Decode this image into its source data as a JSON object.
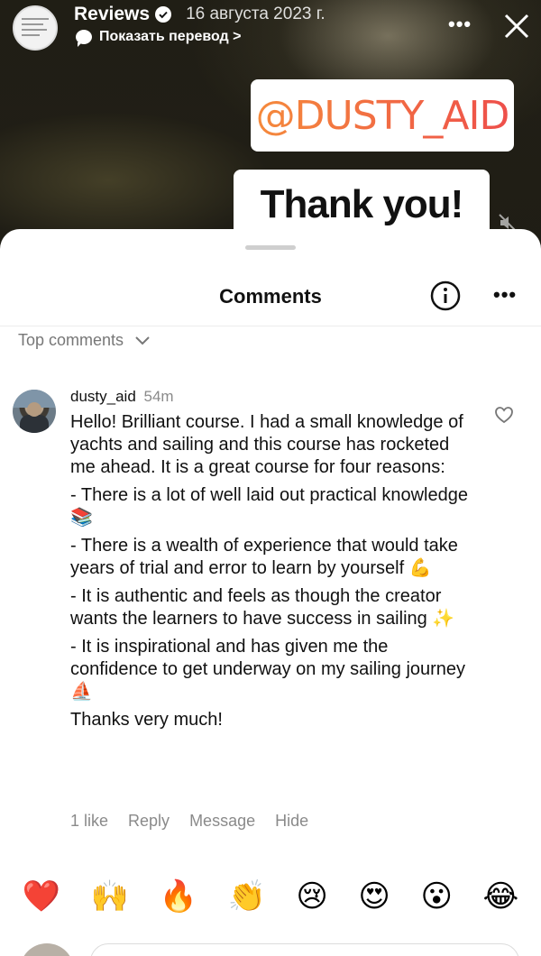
{
  "story": {
    "username": "Reviews",
    "date": "16 августа 2023 г.",
    "translate_label": "Показать перевод >",
    "more_label": "•••",
    "mention_sticker": "@DUSTY_AID",
    "text_sticker": "Thank you!"
  },
  "comments_sheet": {
    "title": "Comments",
    "more_label": "•••",
    "filter_label": "Top comments",
    "comment": {
      "username": "dusty_aid",
      "time": "54m",
      "lines": [
        "Hello! Brilliant course. I had a small knowledge of yachts and sailing and this course has rocketed me ahead. It is a great course for four reasons:",
        "- There is a lot of well laid out practical knowledge 📚",
        "- There is a wealth of experience that would take years of trial and error to learn by yourself 💪",
        "- It is authentic and feels as though the creator wants the learners to have success in sailing ✨",
        "- It is inspirational and has given me the confidence to get underway on my sailing journey ⛵",
        "Thanks very much!"
      ],
      "actions": {
        "likes": "1 like",
        "reply": "Reply",
        "message": "Message",
        "hide": "Hide"
      }
    },
    "reactions": [
      "❤️",
      "🙌",
      "🔥",
      "👏",
      "😢",
      "😍",
      "😮",
      "😂"
    ]
  }
}
